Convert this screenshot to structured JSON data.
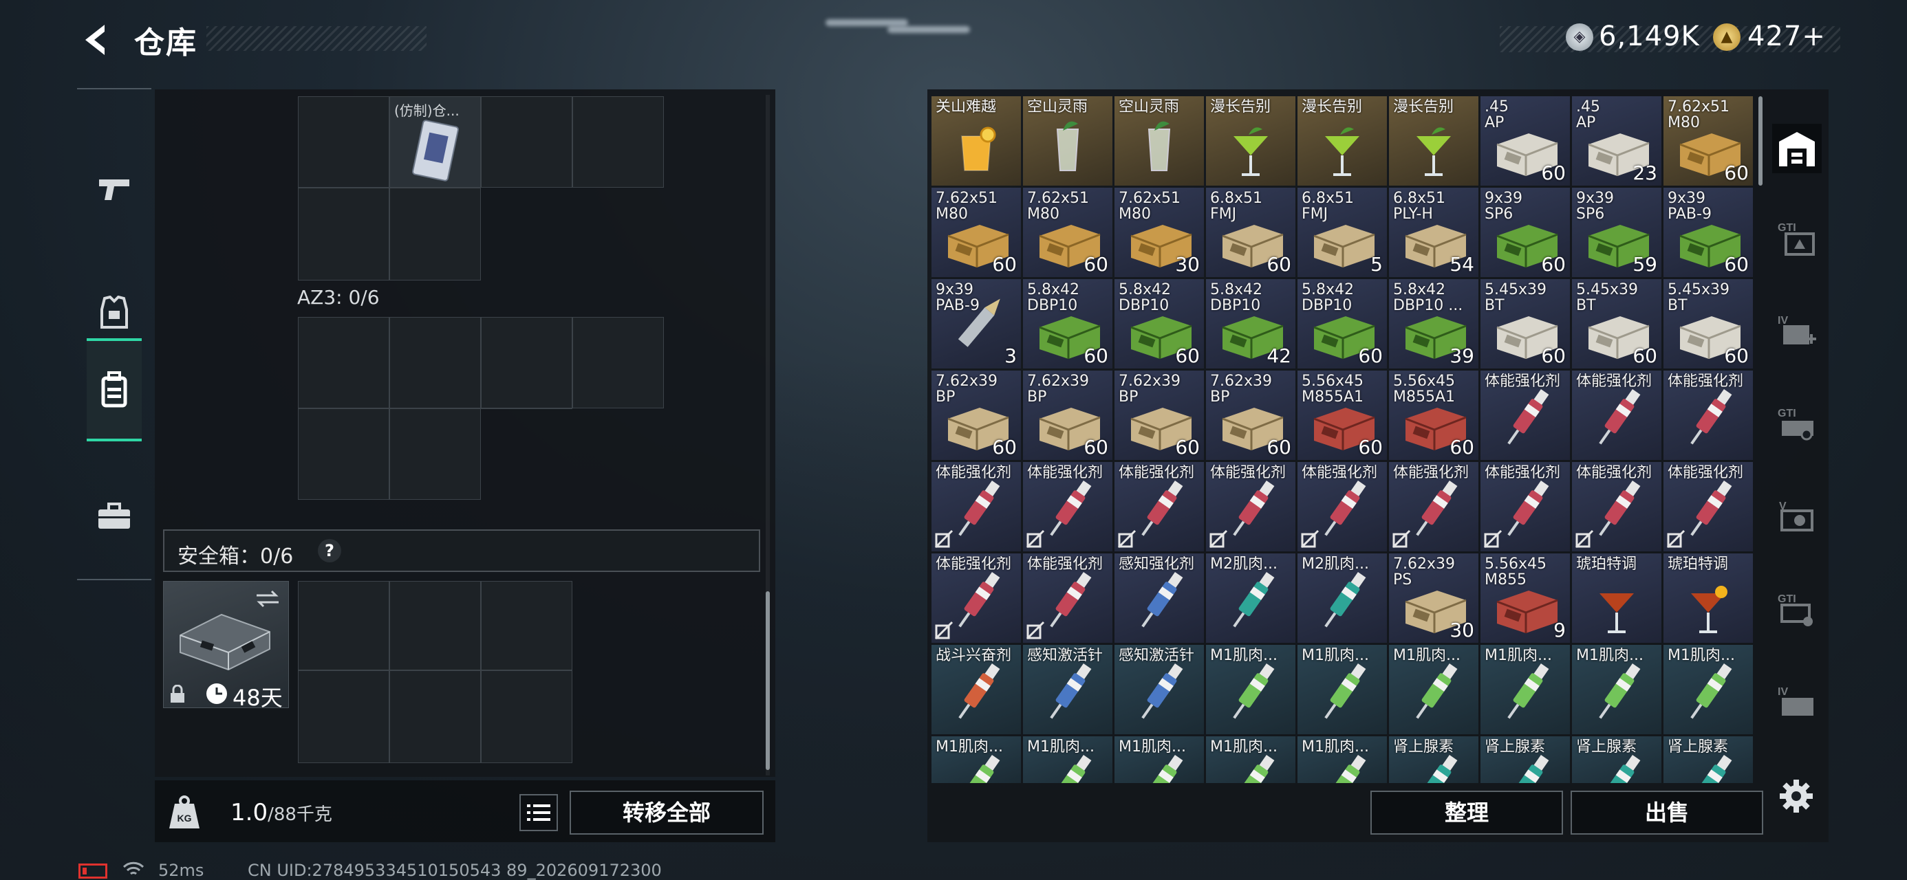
{
  "header": {
    "title": "仓库"
  },
  "currency": [
    {
      "icon": "silver-coin-icon",
      "value": "6,149K"
    },
    {
      "icon": "gold-coin-icon",
      "value": "427+"
    }
  ],
  "left_nav": [
    {
      "name": "weapon-icon",
      "active": false
    },
    {
      "name": "armor-icon",
      "active": false
    },
    {
      "name": "backpack-icon",
      "active": true
    },
    {
      "name": "case-icon",
      "active": false
    }
  ],
  "containers": {
    "top_item": "(仿制)仓...",
    "az3_label": "AZ3: 0/6",
    "safe_box_label": "安全箱：0/6",
    "safe_help": "?",
    "safe_days": "48天"
  },
  "footer_left": {
    "weight_value": "1.0",
    "weight_max": "/88千克",
    "transfer_all": "转移全部"
  },
  "footer_right": {
    "sort": "整理",
    "sell": "出售"
  },
  "status": {
    "ping": "52ms",
    "uid": "CN UID:278495334510150543 89_202609172300"
  },
  "colors": {
    "accent": "#2fd6a5"
  },
  "inventory": [
    [
      {
        "n": "关山难越",
        "q": "",
        "t": "cocktail-orange",
        "bg": "gold"
      },
      {
        "n": "空山灵雨",
        "q": "",
        "t": "cocktail-mint",
        "bg": "gold"
      },
      {
        "n": "空山灵雨",
        "q": "",
        "t": "cocktail-mint",
        "bg": "gold"
      },
      {
        "n": "漫长告别",
        "q": "",
        "t": "cocktail-green",
        "bg": "gold"
      },
      {
        "n": "漫长告别",
        "q": "",
        "t": "cocktail-green",
        "bg": "gold"
      },
      {
        "n": "漫长告别",
        "q": "",
        "t": "cocktail-green",
        "bg": "gold"
      },
      {
        "n": ".45\nAP",
        "q": "60",
        "t": "ammo-white",
        "bg": "blue"
      },
      {
        "n": ".45\nAP",
        "q": "23",
        "t": "ammo-white",
        "bg": "blue"
      },
      {
        "n": "7.62x51\nM80",
        "q": "60",
        "t": "ammo-crate",
        "bg": "gold"
      }
    ],
    [
      {
        "n": "7.62x51\nM80",
        "q": "60",
        "t": "ammo-crate",
        "bg": "blue"
      },
      {
        "n": "7.62x51\nM80",
        "q": "60",
        "t": "ammo-crate",
        "bg": "blue"
      },
      {
        "n": "7.62x51\nM80",
        "q": "30",
        "t": "ammo-crate",
        "bg": "blue"
      },
      {
        "n": "6.8x51\nFMJ",
        "q": "60",
        "t": "ammo-tan",
        "bg": "blue"
      },
      {
        "n": "6.8x51\nFMJ",
        "q": "5",
        "t": "ammo-tan",
        "bg": "blue"
      },
      {
        "n": "6.8x51\nPLY-H",
        "q": "54",
        "t": "ammo-tan",
        "bg": "blue"
      },
      {
        "n": "9x39\nSP6",
        "q": "60",
        "t": "ammo-green",
        "bg": "blue"
      },
      {
        "n": "9x39\nSP6",
        "q": "59",
        "t": "ammo-green",
        "bg": "blue"
      },
      {
        "n": "9x39\nPAB-9",
        "q": "60",
        "t": "ammo-green",
        "bg": "blue"
      }
    ],
    [
      {
        "n": "9x39\nPAB-9",
        "q": "3",
        "t": "bullet",
        "bg": "blue"
      },
      {
        "n": "5.8x42\nDBP10",
        "q": "60",
        "t": "ammo-green",
        "bg": "blue"
      },
      {
        "n": "5.8x42\nDBP10",
        "q": "60",
        "t": "ammo-green",
        "bg": "blue"
      },
      {
        "n": "5.8x42\nDBP10",
        "q": "42",
        "t": "ammo-green",
        "bg": "blue"
      },
      {
        "n": "5.8x42\nDBP10",
        "q": "60",
        "t": "ammo-green",
        "bg": "blue"
      },
      {
        "n": "5.8x42\nDBP10 ...",
        "q": "39",
        "t": "ammo-green",
        "bg": "blue"
      },
      {
        "n": "5.45x39\nBT",
        "q": "60",
        "t": "ammo-white",
        "bg": "blue"
      },
      {
        "n": "5.45x39\nBT",
        "q": "60",
        "t": "ammo-white",
        "bg": "blue"
      },
      {
        "n": "5.45x39\nBT",
        "q": "60",
        "t": "ammo-white",
        "bg": "blue"
      }
    ],
    [
      {
        "n": "7.62x39\nBP",
        "q": "60",
        "t": "ammo-tan",
        "bg": "blue"
      },
      {
        "n": "7.62x39\nBP",
        "q": "60",
        "t": "ammo-tan",
        "bg": "blue"
      },
      {
        "n": "7.62x39\nBP",
        "q": "60",
        "t": "ammo-tan",
        "bg": "blue"
      },
      {
        "n": "7.62x39\nBP",
        "q": "60",
        "t": "ammo-tan",
        "bg": "blue"
      },
      {
        "n": "5.56x45\nM855A1",
        "q": "60",
        "t": "ammo-red",
        "bg": "blue"
      },
      {
        "n": "5.56x45\nM855A1",
        "q": "60",
        "t": "ammo-red",
        "bg": "blue"
      },
      {
        "n": "体能强化剂",
        "q": "",
        "t": "syringe-red",
        "bg": "blue"
      },
      {
        "n": "体能强化剂",
        "q": "",
        "t": "syringe-red",
        "bg": "blue"
      },
      {
        "n": "体能强化剂",
        "q": "",
        "t": "syringe-red",
        "bg": "blue"
      }
    ],
    [
      {
        "n": "体能强化剂",
        "q": "",
        "t": "syringe-red",
        "bg": "blue",
        "x": true
      },
      {
        "n": "体能强化剂",
        "q": "",
        "t": "syringe-red",
        "bg": "blue",
        "x": true
      },
      {
        "n": "体能强化剂",
        "q": "",
        "t": "syringe-red",
        "bg": "blue",
        "x": true
      },
      {
        "n": "体能强化剂",
        "q": "",
        "t": "syringe-red",
        "bg": "blue",
        "x": true
      },
      {
        "n": "体能强化剂",
        "q": "",
        "t": "syringe-red",
        "bg": "blue",
        "x": true
      },
      {
        "n": "体能强化剂",
        "q": "",
        "t": "syringe-red",
        "bg": "blue",
        "x": true
      },
      {
        "n": "体能强化剂",
        "q": "",
        "t": "syringe-red",
        "bg": "blue",
        "x": true
      },
      {
        "n": "体能强化剂",
        "q": "",
        "t": "syringe-red",
        "bg": "blue",
        "x": true
      },
      {
        "n": "体能强化剂",
        "q": "",
        "t": "syringe-red",
        "bg": "blue",
        "x": true
      }
    ],
    [
      {
        "n": "体能强化剂",
        "q": "",
        "t": "syringe-red",
        "bg": "blue",
        "x": true
      },
      {
        "n": "体能强化剂",
        "q": "",
        "t": "syringe-red",
        "bg": "blue",
        "x": true
      },
      {
        "n": "感知强化剂",
        "q": "",
        "t": "syringe-blue",
        "bg": "blue"
      },
      {
        "n": "M2肌肉...",
        "q": "",
        "t": "syringe-teal",
        "bg": "blue"
      },
      {
        "n": "M2肌肉...",
        "q": "",
        "t": "syringe-teal",
        "bg": "blue"
      },
      {
        "n": "7.62x39\nPS",
        "q": "30",
        "t": "ammo-tan",
        "bg": "blue"
      },
      {
        "n": "5.56x45\nM855",
        "q": "9",
        "t": "ammo-red",
        "bg": "blue"
      },
      {
        "n": "琥珀特调",
        "q": "",
        "t": "cocktail-amber",
        "bg": "blue"
      },
      {
        "n": "琥珀特调",
        "q": "",
        "t": "cocktail-amber2",
        "bg": "blue"
      }
    ],
    [
      {
        "n": "战斗兴奋剂",
        "q": "",
        "t": "syringe-orange",
        "bg": "teal"
      },
      {
        "n": "感知激活针",
        "q": "",
        "t": "syringe-blue",
        "bg": "teal"
      },
      {
        "n": "感知激活针",
        "q": "",
        "t": "syringe-blue",
        "bg": "teal"
      },
      {
        "n": "M1肌肉...",
        "q": "",
        "t": "syringe-green",
        "bg": "teal"
      },
      {
        "n": "M1肌肉...",
        "q": "",
        "t": "syringe-green",
        "bg": "teal"
      },
      {
        "n": "M1肌肉...",
        "q": "",
        "t": "syringe-green",
        "bg": "teal"
      },
      {
        "n": "M1肌肉...",
        "q": "",
        "t": "syringe-green",
        "bg": "teal"
      },
      {
        "n": "M1肌肉...",
        "q": "",
        "t": "syringe-green",
        "bg": "teal"
      },
      {
        "n": "M1肌肉...",
        "q": "",
        "t": "syringe-green",
        "bg": "teal"
      }
    ],
    [
      {
        "n": "M1肌肉...",
        "q": "",
        "t": "syringe-green",
        "bg": "teal"
      },
      {
        "n": "M1肌肉...",
        "q": "",
        "t": "syringe-green",
        "bg": "teal"
      },
      {
        "n": "M1肌肉...",
        "q": "",
        "t": "syringe-green",
        "bg": "teal"
      },
      {
        "n": "M1肌肉...",
        "q": "",
        "t": "syringe-green",
        "bg": "teal"
      },
      {
        "n": "M1肌肉...",
        "q": "",
        "t": "syringe-green",
        "bg": "teal"
      },
      {
        "n": "肾上腺素",
        "q": "",
        "t": "syringe-teal",
        "bg": "teal"
      },
      {
        "n": "肾上腺素",
        "q": "",
        "t": "syringe-teal",
        "bg": "teal"
      },
      {
        "n": "肾上腺素",
        "q": "",
        "t": "syringe-teal",
        "bg": "teal"
      },
      {
        "n": "肾上腺素",
        "q": "",
        "t": "syringe-teal",
        "bg": "teal"
      }
    ]
  ],
  "right_nav": [
    {
      "name": "stash-icon"
    },
    {
      "name": "gti-ticket-icon"
    },
    {
      "name": "iv-medkit-icon"
    },
    {
      "name": "gti-vehicle-icon"
    },
    {
      "name": "v-camera-icon"
    },
    {
      "name": "gti-gun-icon"
    },
    {
      "name": "iv-crate-icon"
    }
  ]
}
